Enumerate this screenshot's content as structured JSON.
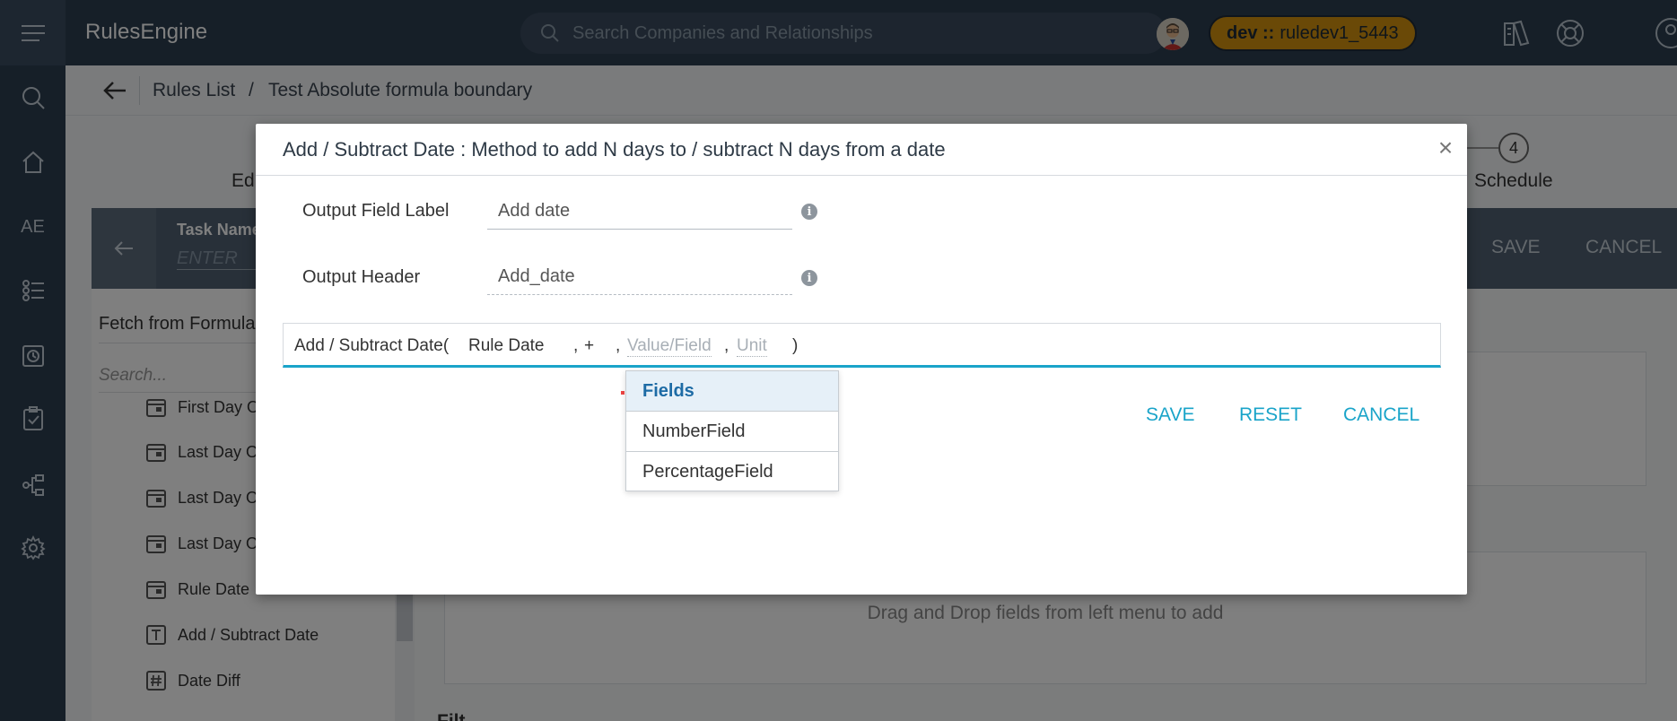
{
  "app": {
    "brand": "RulesEngine"
  },
  "topbar": {
    "search_placeholder": "Search Companies and Relationships",
    "env_prefix": "dev ::",
    "env_name": "ruledev1_5443"
  },
  "left_rail": {
    "items": [
      "hamburger-menu",
      "search",
      "home",
      "AE",
      "rules-list",
      "schedule-clock",
      "checklist",
      "flow-diagram",
      "settings"
    ],
    "ae_label": "AE"
  },
  "breadcrumb": {
    "root": "Rules List",
    "separator": "/",
    "current": "Test Absolute formula boundary"
  },
  "stepper": {
    "left_label_fragment": "Ed",
    "step4_number": "4",
    "step4_label": "Schedule"
  },
  "taskbar": {
    "task_name_label": "Task Name",
    "task_name_placeholder": "ENTER",
    "save": "SAVE",
    "cancel": "CANCEL"
  },
  "left_panel": {
    "fetch_label": "Fetch from Formula",
    "search_placeholder": "Search...",
    "items": [
      {
        "label": "First Day O",
        "icon": "calendar-icon"
      },
      {
        "label": "Last Day O",
        "icon": "calendar-icon"
      },
      {
        "label": "Last Day O",
        "icon": "calendar-icon"
      },
      {
        "label": "Last Day O",
        "icon": "calendar-icon"
      },
      {
        "label": "Rule Date",
        "icon": "calendar-icon"
      },
      {
        "label": "Add / Subtract Date",
        "icon": "text-field-icon"
      },
      {
        "label": "Date Diff",
        "icon": "number-field-icon"
      }
    ]
  },
  "right_panel": {
    "drop_hint": "Drag and Drop fields from left menu to add",
    "filters_label": "Filt"
  },
  "modal": {
    "title": "Add / Subtract Date : Method to add N days to / subtract N days from a date",
    "close": "×",
    "output_field_label": "Output Field Label",
    "output_field_value": "Add date",
    "output_header_label": "Output Header",
    "output_header_value": "Add_date",
    "formula": {
      "func": "Add / Subtract Date(",
      "arg1": "Rule Date",
      "comma1": ",",
      "arg2": "+",
      "comma2": ",",
      "arg3_placeholder": "Value/Field",
      "comma3": ",",
      "arg4_placeholder": "Unit",
      "close_paren": ")"
    },
    "dropdown": {
      "header": "Fields",
      "options": [
        "NumberField",
        "PercentageField"
      ]
    },
    "buttons": {
      "save": "SAVE",
      "reset": "RESET",
      "cancel": "CANCEL"
    },
    "info_glyph": "i"
  },
  "colors": {
    "nav_bg": "#2d3e50",
    "accent": "#1aa4c9",
    "env_badge": "#d4930e",
    "dropdown_header": "#1d6ba5"
  }
}
